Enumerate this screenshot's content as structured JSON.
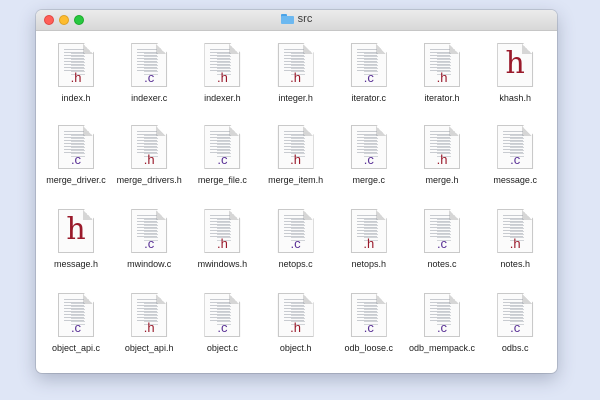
{
  "window": {
    "title": "src",
    "title_icon": "folder-icon"
  },
  "files": [
    {
      "name": "index.h",
      "ext": ".h",
      "type": "h",
      "preview": "code"
    },
    {
      "name": "indexer.c",
      "ext": ".c",
      "type": "c",
      "preview": "code"
    },
    {
      "name": "indexer.h",
      "ext": ".h",
      "type": "h",
      "preview": "code"
    },
    {
      "name": "integer.h",
      "ext": ".h",
      "type": "h",
      "preview": "code"
    },
    {
      "name": "iterator.c",
      "ext": ".c",
      "type": "c",
      "preview": "code"
    },
    {
      "name": "iterator.h",
      "ext": ".h",
      "type": "h",
      "preview": "code"
    },
    {
      "name": "khash.h",
      "ext": "h",
      "type": "h",
      "preview": "big"
    },
    {
      "name": "merge_driver.c",
      "ext": ".c",
      "type": "c",
      "preview": "code"
    },
    {
      "name": "merge_drivers.h",
      "ext": ".h",
      "type": "h",
      "preview": "code"
    },
    {
      "name": "merge_file.c",
      "ext": ".c",
      "type": "c",
      "preview": "code"
    },
    {
      "name": "merge_item.h",
      "ext": ".h",
      "type": "h",
      "preview": "code"
    },
    {
      "name": "merge.c",
      "ext": ".c",
      "type": "c",
      "preview": "code"
    },
    {
      "name": "merge.h",
      "ext": ".h",
      "type": "h",
      "preview": "code"
    },
    {
      "name": "message.c",
      "ext": ".c",
      "type": "c",
      "preview": "code"
    },
    {
      "name": "message.h",
      "ext": "h",
      "type": "h",
      "preview": "big"
    },
    {
      "name": "mwindow.c",
      "ext": ".c",
      "type": "c",
      "preview": "code"
    },
    {
      "name": "mwindows.h",
      "ext": ".h",
      "type": "h",
      "preview": "code"
    },
    {
      "name": "netops.c",
      "ext": ".c",
      "type": "c",
      "preview": "code"
    },
    {
      "name": "netops.h",
      "ext": ".h",
      "type": "h",
      "preview": "code"
    },
    {
      "name": "notes.c",
      "ext": ".c",
      "type": "c",
      "preview": "code"
    },
    {
      "name": "notes.h",
      "ext": ".h",
      "type": "h",
      "preview": "code"
    },
    {
      "name": "object_api.c",
      "ext": ".c",
      "type": "c",
      "preview": "code"
    },
    {
      "name": "object_api.h",
      "ext": ".h",
      "type": "h",
      "preview": "code"
    },
    {
      "name": "object.c",
      "ext": ".c",
      "type": "c",
      "preview": "code"
    },
    {
      "name": "object.h",
      "ext": ".h",
      "type": "h",
      "preview": "code"
    },
    {
      "name": "odb_loose.c",
      "ext": ".c",
      "type": "c",
      "preview": "code"
    },
    {
      "name": "odb_mempack.c",
      "ext": ".c",
      "type": "c",
      "preview": "code"
    },
    {
      "name": "odbs.c",
      "ext": ".c",
      "type": "c",
      "preview": "code"
    }
  ]
}
